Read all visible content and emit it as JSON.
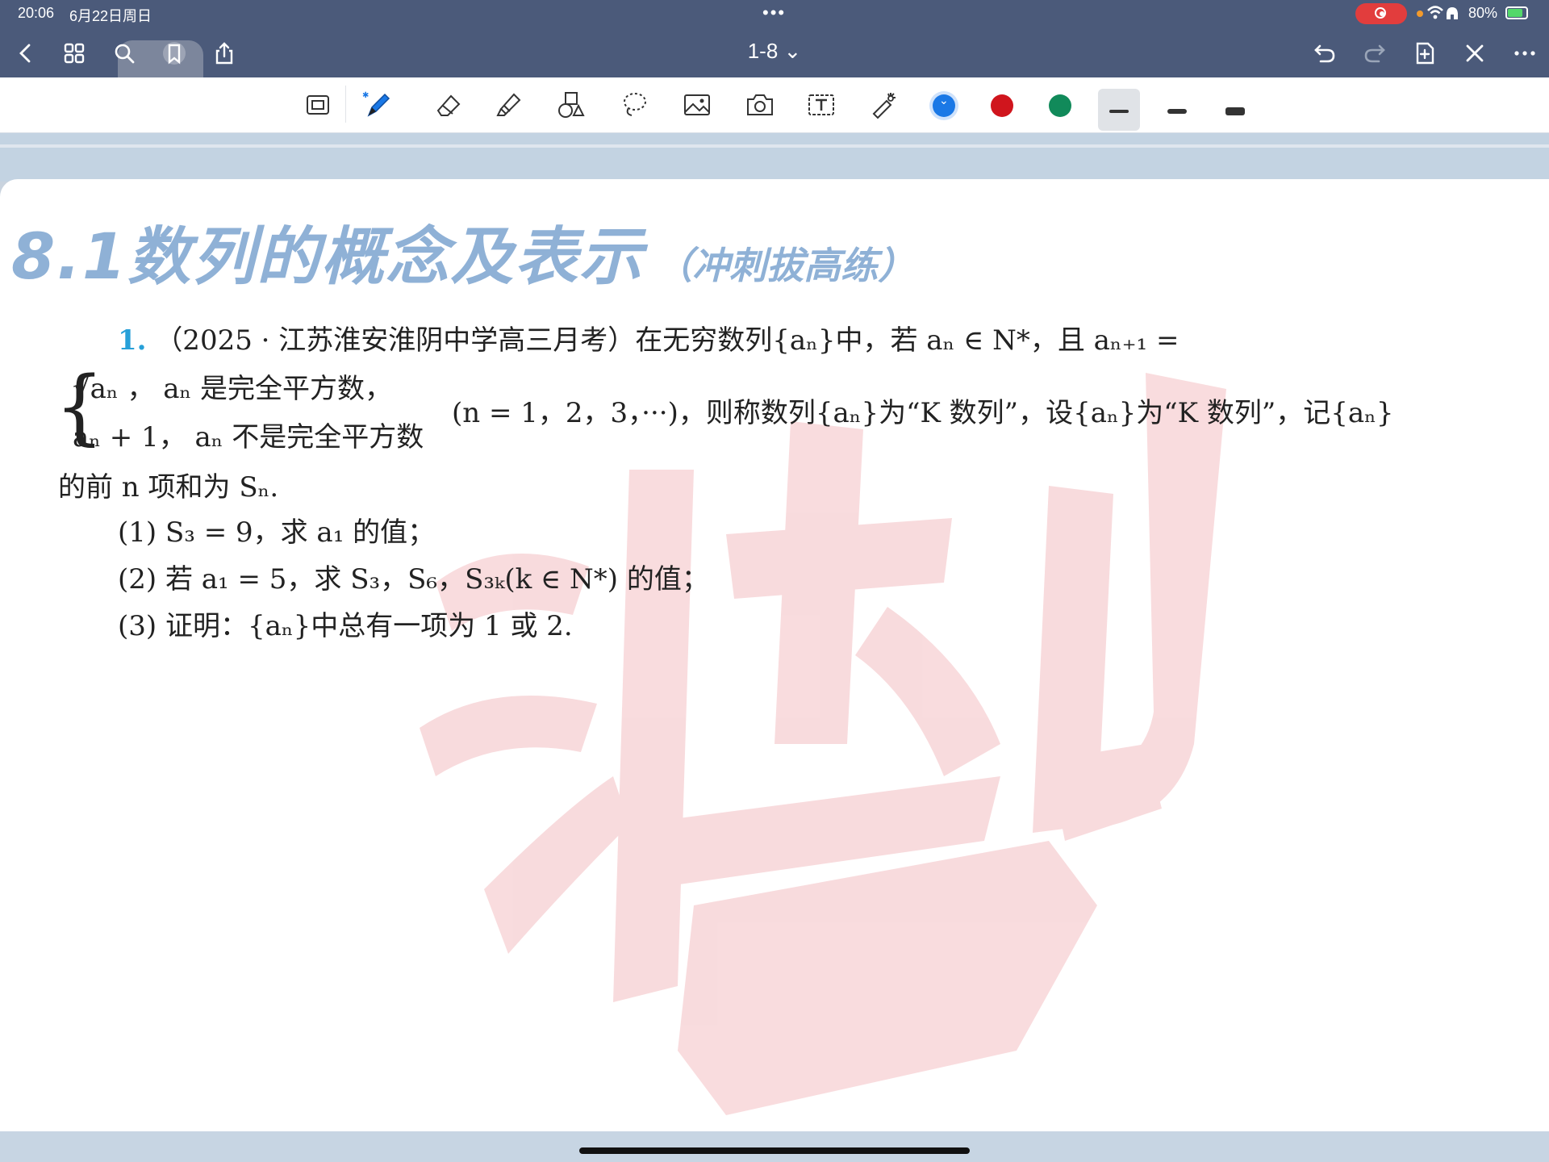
{
  "status": {
    "time": "20:06",
    "date": "6月22日周日",
    "battery": "80%",
    "battery_level": 0.8
  },
  "nav": {
    "doc_title": "1-8 ⌄",
    "icons": [
      "back-icon",
      "grid-icon",
      "search-icon",
      "bookmark-icon",
      "share-icon",
      "undo-icon",
      "redo-icon",
      "add-page-icon",
      "close-icon",
      "more-icon"
    ]
  },
  "tools": {
    "items": [
      "page-icon",
      "pen-icon",
      "eraser-icon",
      "highlighter-icon",
      "shapes-icon",
      "lasso-icon",
      "image-icon",
      "camera-icon",
      "text-icon",
      "laser-icon"
    ],
    "colors": [
      "#1a78e6",
      "#d0151d",
      "#118a5a"
    ],
    "selected_color": "#1a78e6",
    "thickness": [
      "thin",
      "medium",
      "thick"
    ],
    "selected_thickness": "thin"
  },
  "doc": {
    "heading": "8.1数列的概念及表示",
    "subheading": "（冲刺拔高练）",
    "q_num": "1.",
    "line1": "（2025 · 江苏淮安淮阴中学高三月考）在无穷数列{aₙ}中，若 aₙ ∈ N*，且 aₙ₊₁ =",
    "case1": "√aₙ ，     aₙ 是完全平方数，",
    "case2": "aₙ + 1，   aₙ 不是完全平方数",
    "line2_tail": "(n = 1，2，3，···)，则称数列{aₙ}为“K 数列”，设{aₙ}为“K 数列”，记{aₙ}",
    "line3": "的前 n 项和为 Sₙ.",
    "sub1": "(1) S₃ = 9，求 a₁ 的值；",
    "sub2": "(2) 若 a₁ = 5，求 S₃，S₆，S₃ₖ(k ∈ N*) 的值；",
    "sub3": "(3) 证明：{aₙ}中总有一项为 1 或 2."
  }
}
